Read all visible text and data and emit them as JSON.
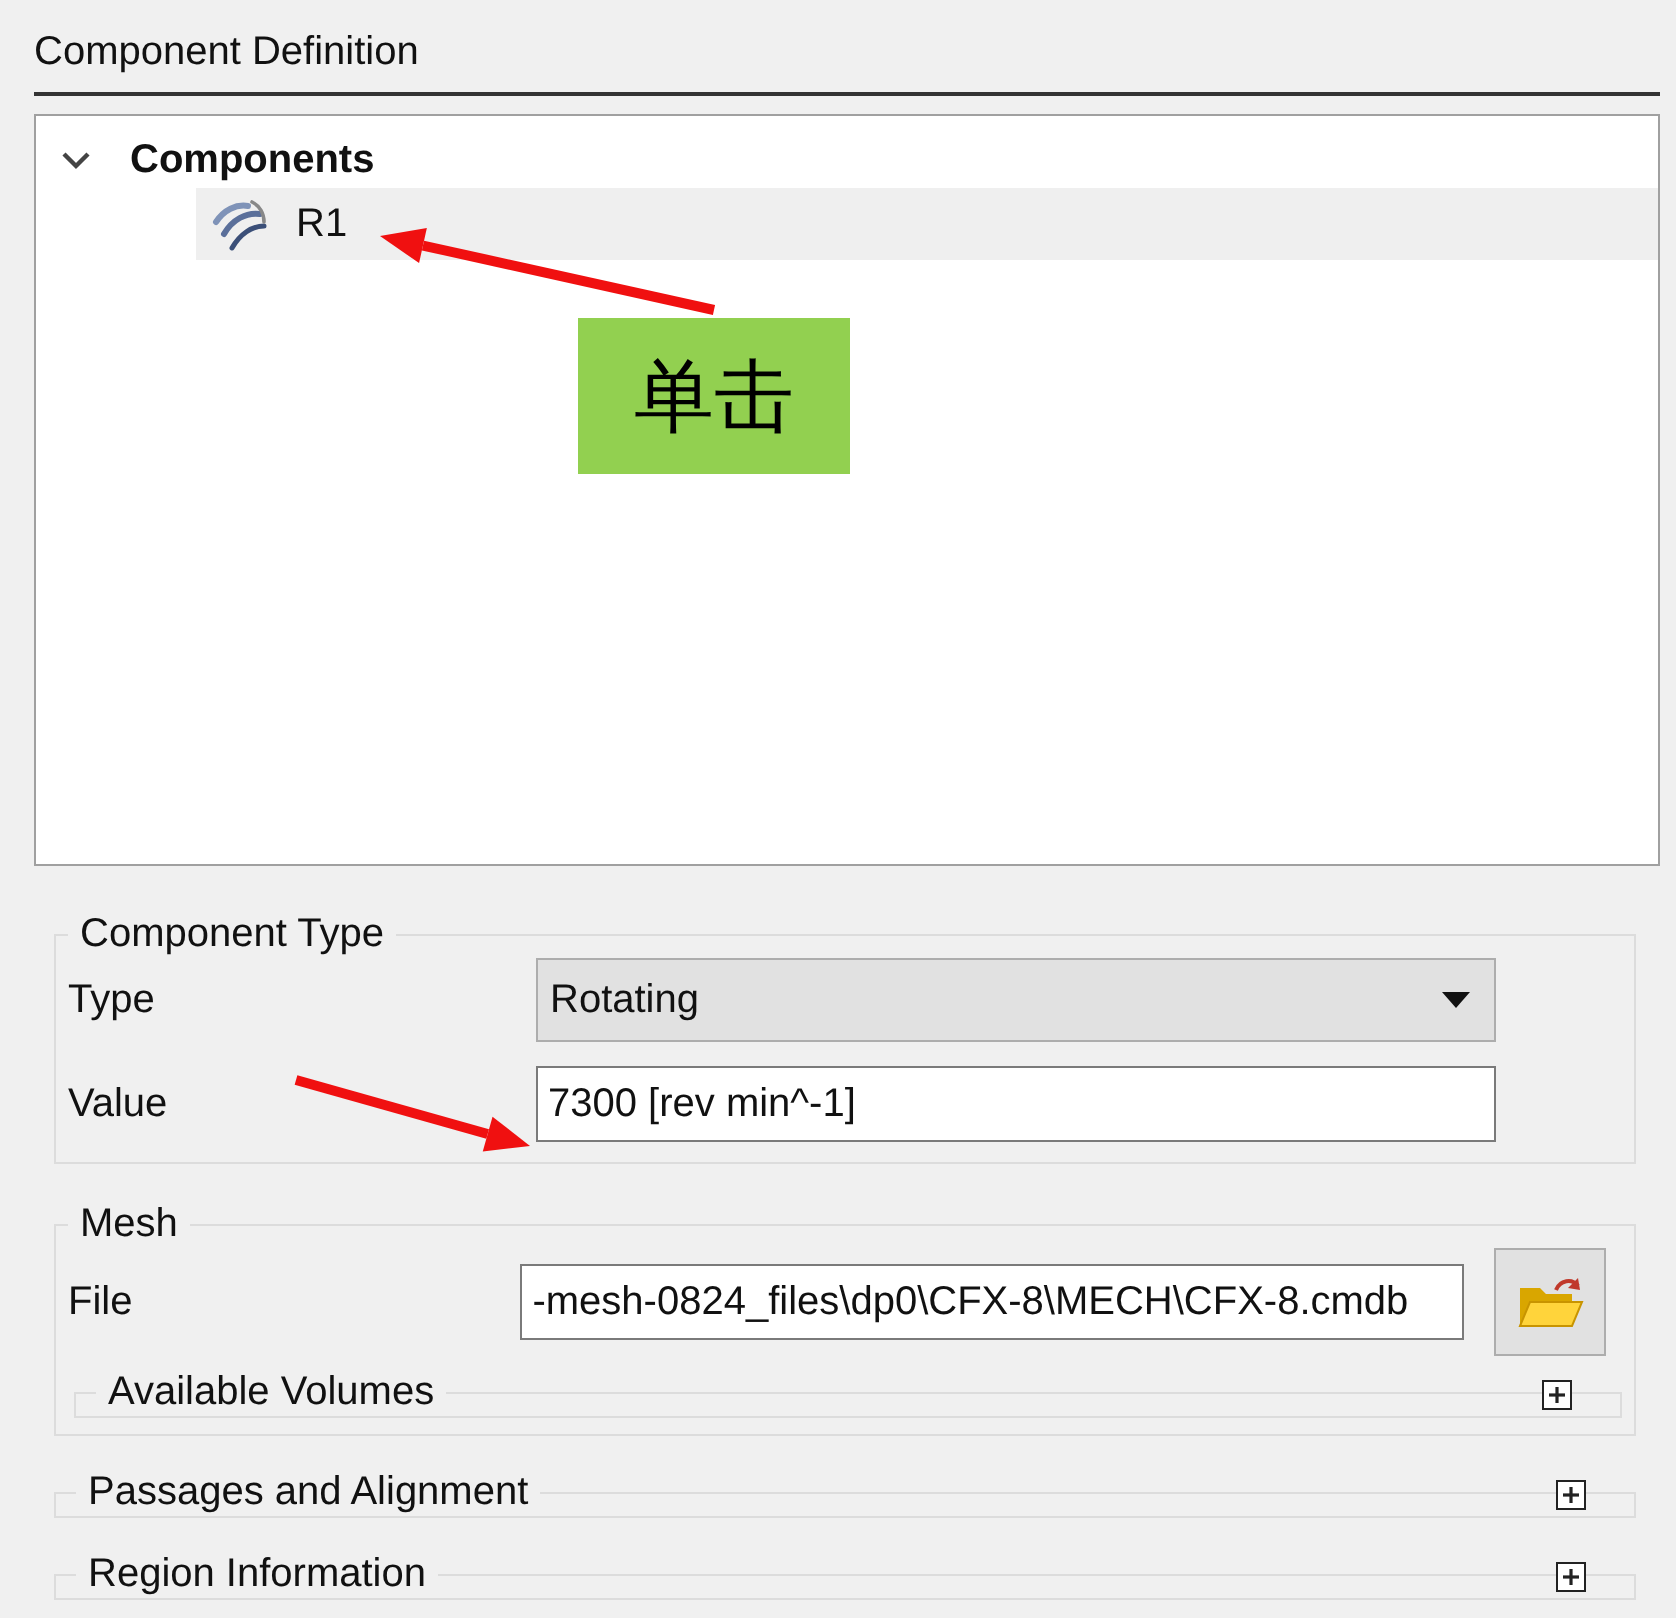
{
  "panel": {
    "title": "Component Definition"
  },
  "tree": [
    {
      "label": "Components",
      "expanded": true,
      "children": [
        {
          "label": "R1",
          "selected": true
        }
      ]
    }
  ],
  "component_type": {
    "title": "Component Type",
    "fields": [
      {
        "label": "Type",
        "kind": "dropdown",
        "value": "Rotating"
      },
      {
        "label": "Value",
        "kind": "text",
        "value": "7300 [rev min^-1]"
      }
    ]
  },
  "mesh": {
    "title": "Mesh",
    "file": {
      "label": "File",
      "value": "-mesh-0824_files\\dp0\\CFX-8\\MECH\\CFX-8.cmdb"
    },
    "subsections": [
      {
        "title": "Available Volumes",
        "expanded": false
      }
    ]
  },
  "sections": [
    {
      "title": "Passages and Alignment",
      "expanded": false
    },
    {
      "title": "Region Information",
      "expanded": false
    }
  ],
  "annotations": [
    {
      "kind": "arrow"
    },
    {
      "kind": "callout",
      "text": "单击"
    },
    {
      "kind": "arrow"
    }
  ]
}
